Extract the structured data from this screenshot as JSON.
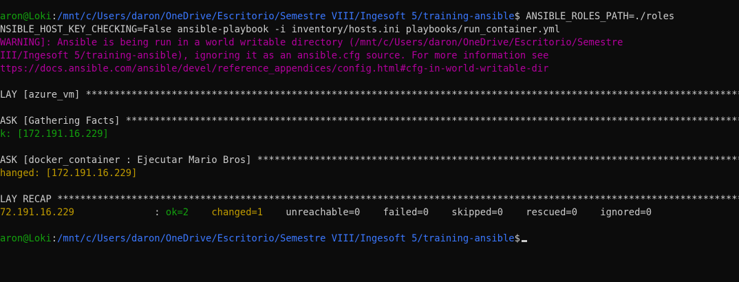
{
  "terminal": {
    "prompt": {
      "user_host": "aron@Loki",
      "colon": ":",
      "path": "/mnt/c/Users/daron/OneDrive/Escritorio/Semestre VIII/Ingesoft 5/training-ansible",
      "symbol": "$"
    },
    "command_part1": " ANSIBLE_ROLES_PATH=./roles",
    "command_part2": "NSIBLE_HOST_KEY_CHECKING=False ansible-playbook -i inventory/hosts.ini playbooks/run_container.yml",
    "warning_lines": [
      "WARNING]: Ansible is being run in a world writable directory (/mnt/c/Users/daron/OneDrive/Escritorio/Semestre",
      "III/Ingesoft 5/training-ansible), ignoring it as an ansible.cfg source. For more information see",
      "ttps://docs.ansible.com/ansible/devel/reference_appendices/config.html#cfg-in-world-writable-dir"
    ],
    "play_header": "LAY [azure_vm] ************************************************************************************************************************",
    "task1_header": "ASK [Gathering Facts] *****************************************************************************************************************",
    "task1_result": "k: [172.191.16.229]",
    "task2_header": "ASK [docker_container : Ejecutar Mario Bros] ******************************************************************************************",
    "task2_result": "hanged: [172.191.16.229]",
    "recap_header": "LAY RECAP *****************************************************************************************************************************",
    "recap": {
      "host": "72.191.16.229",
      "sep": "              : ",
      "ok": "ok=2",
      "changed": "changed=1",
      "unreachable": "unreachable=0",
      "failed": "failed=0",
      "skipped": "skipped=0",
      "rescued": "rescued=0",
      "ignored": "ignored=0"
    },
    "colors": {
      "background": "#0c0c0c",
      "text": "#cccccc",
      "green": "#13a10e",
      "blue": "#3b78ff",
      "magenta": "#b4009e",
      "yellow": "#c19c00"
    }
  }
}
